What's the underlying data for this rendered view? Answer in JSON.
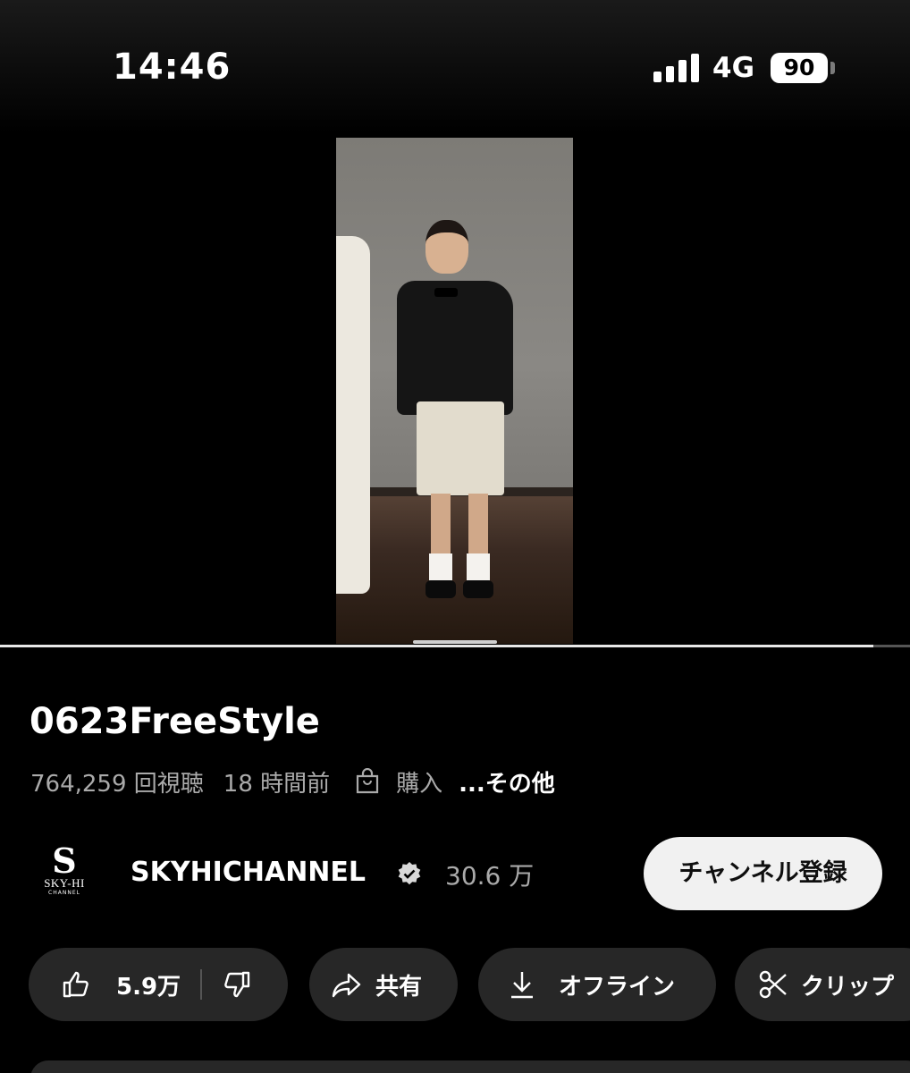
{
  "status_bar": {
    "time": "14:46",
    "network": "4G",
    "battery": "90",
    "signal_bars": 4
  },
  "video": {
    "progress_fraction": 0.96
  },
  "info": {
    "title": "0623FreeStyle",
    "views": "764,259 回視聴",
    "age": "18 時間前",
    "buy_label": "購入",
    "more_label": "...その他"
  },
  "channel": {
    "logo_letter": "S",
    "logo_name": "SKY-HI",
    "logo_sub": "CHANNEL",
    "name": "SKYHICHANNEL",
    "subscribers": "30.6 万",
    "subscribe_label": "チャンネル登録"
  },
  "actions": {
    "like_count": "5.9万",
    "share_label": "共有",
    "offline_label": "オフライン",
    "clip_label": "クリップ"
  },
  "colors": {
    "background": "#000000",
    "chip": "#272727",
    "subscribe_bg": "#f1f1f1",
    "muted_text": "#aaaaaa"
  }
}
